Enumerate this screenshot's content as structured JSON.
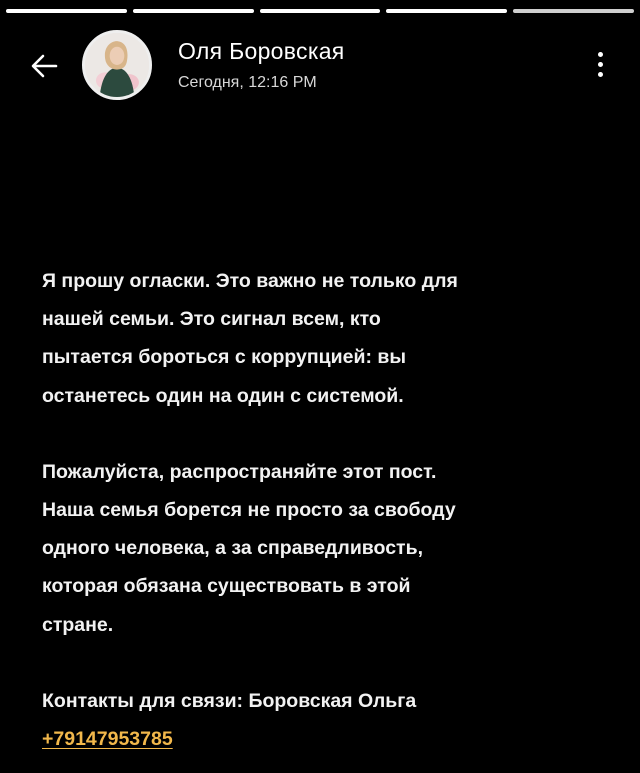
{
  "progress": {
    "segments": 5,
    "active_index": 4
  },
  "header": {
    "back_icon": "arrow-left-icon",
    "author_name": "Оля Боровская",
    "timestamp": "Сегодня, 12:16 PM",
    "avatar_icon": "profile-photo",
    "more_icon": "more-vertical-icon"
  },
  "story": {
    "paragraph1": "Я прошу огласки. Это важно не только для\nнашей семьи. Это сигнал всем, кто\nпытается бороться с коррупцией: вы\nостанетесь один на один с системой.",
    "paragraph2": "Пожалуйста, распространяйте этот пост.\nНаша семья борется не просто за свободу\nодного человека, а за справедливость,\nкоторая обязана существовать в этой\nстране.",
    "contacts_label": "Контакты для связи: Боровская Ольга",
    "phone": "+79147953785"
  },
  "colors": {
    "background": "#000000",
    "text": "#f2f2f2",
    "link": "#f2b84b"
  }
}
